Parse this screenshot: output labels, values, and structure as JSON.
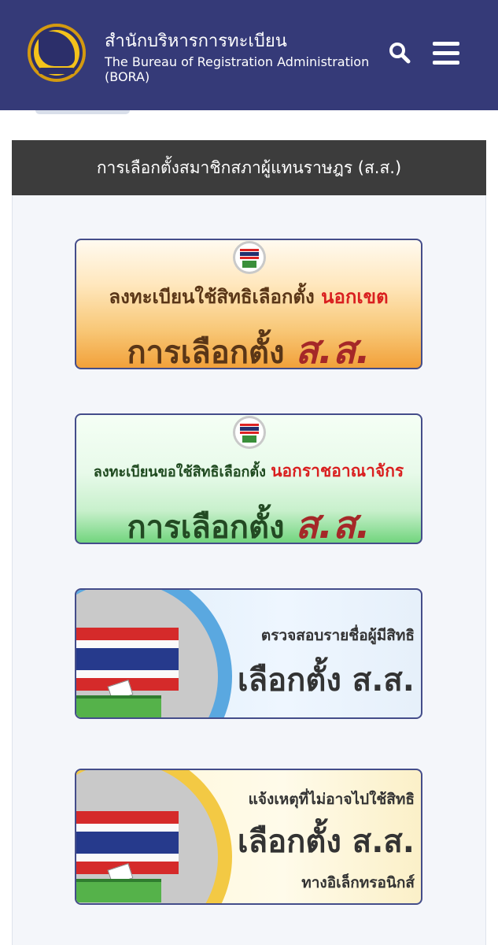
{
  "header": {
    "title_th": "สำนักบริหารการทะเบียน",
    "title_en": "The Bureau of Registration Administration (BORA)",
    "search_icon": "search-icon",
    "menu_icon": "hamburger-menu-icon",
    "background_color": "#353a78"
  },
  "section": {
    "title": "การเลือกตั้งสมาชิกสภาผู้แทนราษฎร (ส.ส.)"
  },
  "banners": [
    {
      "line1": "ลงทะเบียนใช้สิทธิเลือกตั้ง",
      "line1_highlight": "นอกเขต",
      "line2": "การเลือกตั้ง",
      "highlight": "ส.ส."
    },
    {
      "line1": "ลงทะเบียนขอใช้สิทธิเลือกตั้ง",
      "line1_highlight": "นอกราชอาณาจักร",
      "line2": "การเลือกตั้ง",
      "highlight": "ส.ส."
    },
    {
      "line1": "ตรวจสอบรายชื่อผู้มีสิทธิ",
      "line2": "เลือกตั้ง ส.ส."
    },
    {
      "line1": "แจ้งเหตุที่ไม่อาจไปใช้สิทธิ",
      "line2": "เลือกตั้ง ส.ส.",
      "line3": "ทางอิเล็กทรอนิกส์"
    }
  ]
}
